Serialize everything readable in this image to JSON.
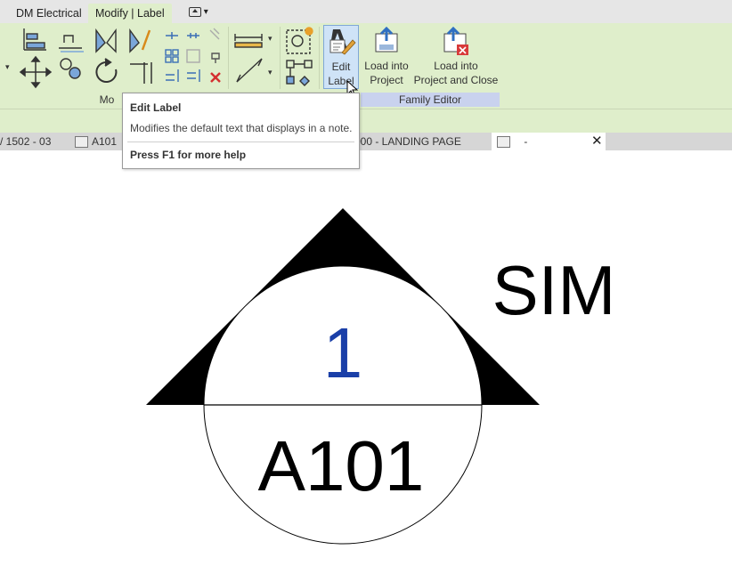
{
  "tabs": [
    {
      "label": "DM Electrical"
    },
    {
      "label": "Modify | Label"
    }
  ],
  "tab_switcher_icon": "panel-switch-icon",
  "ribbon": {
    "panels": {
      "modify": "Mo",
      "family_editor": "Family Editor"
    },
    "buttons": {
      "edit_label": [
        "Edit",
        "Label"
      ],
      "load_into_project": [
        "Load into",
        "Project"
      ],
      "load_into_project_close": [
        "Load into",
        "Project and Close"
      ]
    }
  },
  "view_tabs": {
    "left_partial": "/ 1502 - 03",
    "a101": "A101",
    "landing": "000 - LANDING PAGE",
    "active": "-",
    "close": "✕"
  },
  "tooltip": {
    "title": "Edit Label",
    "description": "Modifies the default text that displays in a note.",
    "help": "Press F1 for more help"
  },
  "annotation": {
    "detail_number": "1",
    "sheet_number": "A101",
    "suffix": "SIM",
    "detail_color": "#1a3fa8"
  },
  "colors": {
    "ribbon_green": "#dfeecb",
    "family_panel_label": "#c9d2ee",
    "active_button": "#cfe3f7"
  }
}
